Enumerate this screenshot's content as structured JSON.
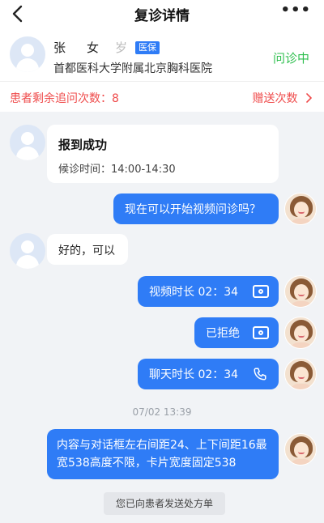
{
  "nav": {
    "title": "复诊详情",
    "more": "•••"
  },
  "patient": {
    "name": "张",
    "gender": "女",
    "age": "岁",
    "insurance_badge": "医保",
    "hospital": "首都医科大学附属北京胸科医院",
    "status": "问诊中",
    "status_color": "#2fbf4f"
  },
  "quota": {
    "remaining_label": "患者剩余追问次数：8",
    "gift_label": "赠送次数"
  },
  "messages": {
    "checkin_title": "报到成功",
    "checkin_time": "候诊时间：14:00-14:30",
    "doctor_ask_video": "现在可以开始视频问诊吗？",
    "patient_ok": "好的，可以",
    "video_duration": "视频时长 02：34",
    "rejected": "已拒绝",
    "chat_duration": "聊天时长 02：34",
    "timestamp": "07/02 13:39",
    "long_text": "内容与对话框左右间距24、上下间距16最宽538高度不限，卡片宽度固定538",
    "system_notice": "您已向患者发送处方单"
  },
  "colors": {
    "accent": "#2f7cf6",
    "alert": "#ef4b4b",
    "chat_bg": "#f1f3f6"
  }
}
